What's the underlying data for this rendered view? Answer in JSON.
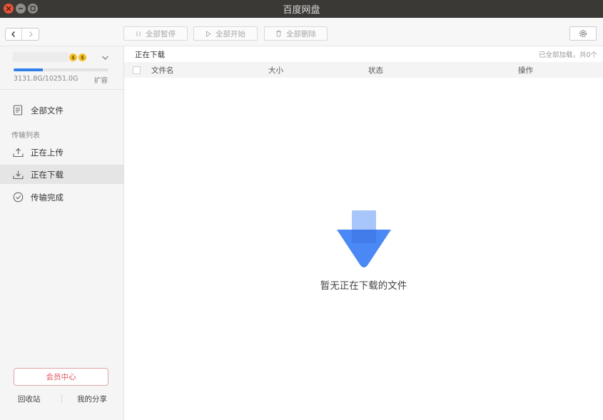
{
  "window": {
    "title": "百度网盘"
  },
  "toolbar": {
    "pause_all": "全部暂停",
    "start_all": "全部开始",
    "delete_all": "全部删除"
  },
  "user": {
    "coin1": "$",
    "coin2": "$",
    "quota_used_fraction": 0.305,
    "quota_text": "3131.8G/10251.0G",
    "expand": "扩容"
  },
  "sidebar": {
    "all_files": "全部文件",
    "section_label": "传输列表",
    "uploading": "正在上传",
    "downloading": "正在下载",
    "completed": "传输完成",
    "vip_center": "会员中心",
    "recycle_bin": "回收站",
    "my_share": "我的分享"
  },
  "main": {
    "title": "正在下载",
    "count": "已全部加载，共0个",
    "columns": {
      "name": "文件名",
      "size": "大小",
      "status": "状态",
      "action": "操作"
    },
    "empty_message": "暂无正在下载的文件"
  },
  "colors": {
    "accent": "#2f80e8",
    "vip": "#e0525d",
    "empty_icon_primary": "#4a88f5",
    "empty_icon_light": "#a9c6fb"
  }
}
